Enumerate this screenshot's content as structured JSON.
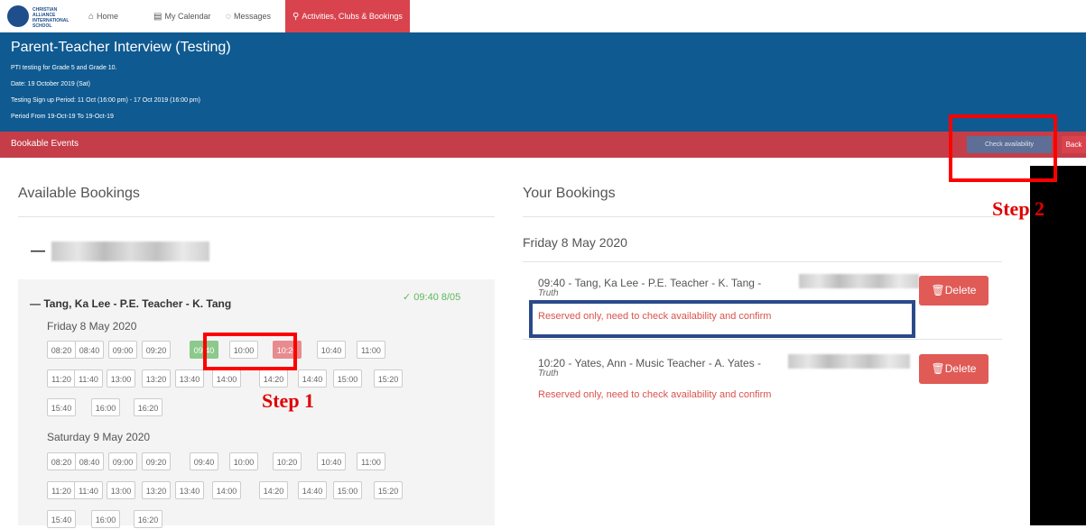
{
  "nav": {
    "logo_line1": "CHRISTIAN ALLIANCE",
    "logo_line2": "INTERNATIONAL SCHOOL",
    "items": [
      {
        "label": "Home",
        "icon": "home-icon"
      },
      {
        "label": "My Calendar",
        "icon": "calendar-icon"
      },
      {
        "label": "Messages",
        "icon": "messages-icon"
      },
      {
        "label": "Activities, Clubs & Bookings",
        "icon": "activities-icon"
      }
    ]
  },
  "header": {
    "title": "Parent-Teacher Interview (Testing)",
    "line1": "PTI testing for Grade 5 and Grade 10.",
    "line2": "Date: 19 October 2019 (Sat)",
    "line3": "Testing Sign up Period: 11 Oct (16:00 pm) - 17 Oct 2019 (16:00 pm)",
    "line4": "Period From   19-Oct-19   To   19-Oct-19"
  },
  "bookbar": {
    "label": "Bookable Events",
    "check_label": "Check availability",
    "back_label": "Back"
  },
  "available": {
    "title": "Available Bookings",
    "teacher": "Tang, Ka Lee - P.E. Teacher - K. Tang",
    "booked_note": "09:40 8/05",
    "day1": "Friday 8 May 2020",
    "day2": "Saturday 9 May 2020",
    "slots": [
      "08:20",
      "08:40",
      "09:00",
      "09:20",
      "09:40",
      "10:00",
      "10:20",
      "10:40",
      "11:00",
      "11:20",
      "11:40",
      "13:00",
      "13:20",
      "13:40",
      "14:00",
      "14:20",
      "14:40",
      "15:00",
      "15:20",
      "15:40",
      "16:00",
      "16:20"
    ],
    "day1_selected": "09:40",
    "day1_taken": "10:20"
  },
  "yours": {
    "title": "Your Bookings",
    "date": "Friday 8 May 2020",
    "bookings": [
      {
        "text": "09:40 - Tang, Ka Lee - P.E. Teacher - K. Tang -",
        "sub": "Truth",
        "warn": "Reserved only, need to check availability and confirm",
        "delete": "Delete"
      },
      {
        "text": "10:20 - Yates, Ann - Music Teacher - A. Yates -",
        "sub": "Truth",
        "warn": "Reserved only, need to check availability and confirm",
        "delete": "Delete"
      }
    ]
  },
  "annotations": {
    "step1": "Step 1",
    "step2": "Step 2"
  },
  "colors": {
    "header_blue": "#0f5a91",
    "accent_red": "#c53d48",
    "slot_green": "#8cc98c",
    "slot_red": "#e88b8f"
  }
}
